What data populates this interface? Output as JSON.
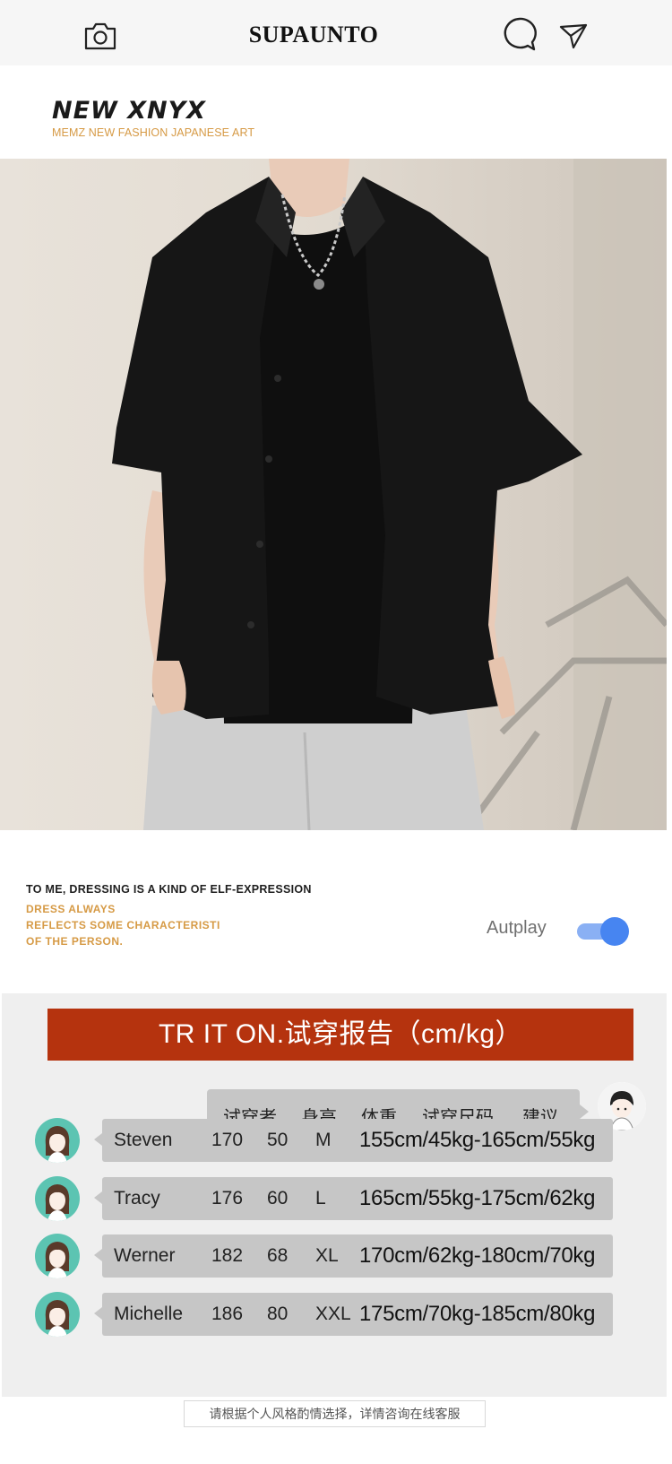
{
  "header": {
    "title": "SUPAUNTO",
    "left_icon": "camera-icon",
    "right_icons": [
      "chat-bubble-icon",
      "send-icon"
    ]
  },
  "brand": {
    "name": "NEW XNYX",
    "subtitle": "MEMZ NEW FASHION JAPANESE ART"
  },
  "hero": {
    "description_icon": "product-photo"
  },
  "quote": {
    "line1": "TO ME, DRESSING IS A KIND OF   ELF-EXPRESSION",
    "line2": "DRESS ALWAYS",
    "line3": "REFLECTS SOME CHARACTERISTI",
    "line4": "OF THE PERSON."
  },
  "autoplay": {
    "label": "Autplay",
    "on": true,
    "accent": "#4785f1"
  },
  "tryon": {
    "banner": "TR   IT ON.试穿报告（cm/kg）",
    "banner_color": "#b5330e",
    "headers": [
      "试穿者",
      "身高",
      "体重",
      "试穿尺码",
      "建议"
    ],
    "rows": [
      {
        "name": "Steven",
        "height": "170",
        "weight": "50",
        "size": "M",
        "suggestion": "155cm/45kg-165cm/55kg"
      },
      {
        "name": "Tracy",
        "height": "176",
        "weight": "60",
        "size": "L",
        "suggestion": "165cm/55kg-175cm/62kg"
      },
      {
        "name": "Werner",
        "height": "182",
        "weight": "68",
        "size": "XL",
        "suggestion": "170cm/62kg-180cm/70kg"
      },
      {
        "name": "Michelle",
        "height": "186",
        "weight": "80",
        "size": "XXL",
        "suggestion": "175cm/70kg-185cm/80kg"
      }
    ]
  },
  "footer": {
    "note": "请根据个人风格酌情选择，详情咨询在线客服"
  }
}
